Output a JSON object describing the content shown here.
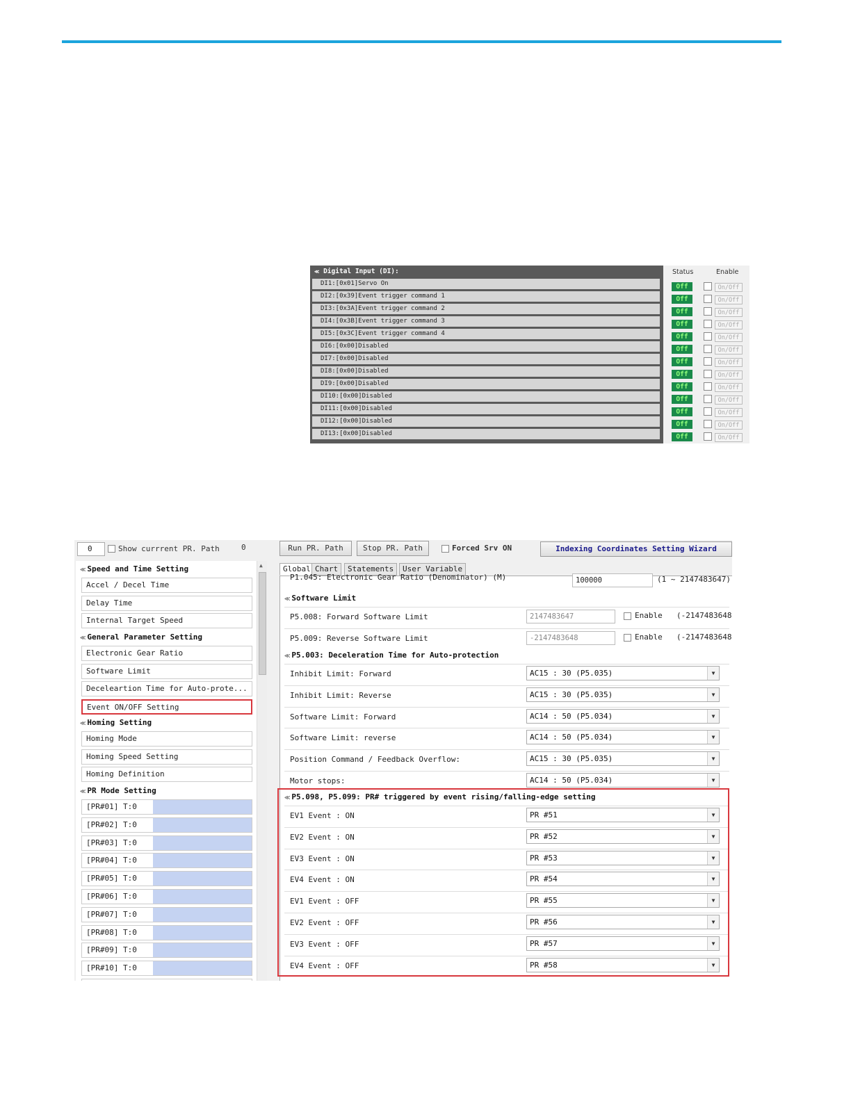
{
  "di_panel": {
    "header": "Digital Input (DI):",
    "status_col": "Status",
    "enable_col": "Enable",
    "status_value": "Off",
    "enable_button": "On/Off",
    "rows": [
      "DI1:[0x01]Servo On",
      "DI2:[0x39]Event trigger command 1",
      "DI3:[0x3A]Event trigger command 2",
      "DI4:[0x3B]Event trigger command 3",
      "DI5:[0x3C]Event trigger command 4",
      "DI6:[0x00]Disabled",
      "DI7:[0x00]Disabled",
      "DI8:[0x00]Disabled",
      "DI9:[0x00]Disabled",
      "DI10:[0x00]Disabled",
      "DI11:[0x00]Disabled",
      "DI12:[0x00]Disabled",
      "DI13:[0x00]Disabled"
    ]
  },
  "toolbar": {
    "pr_number": "0",
    "show_path_label": "Show currrent PR. Path",
    "path_value": "0",
    "run_button": "Run PR. Path",
    "stop_button": "Stop PR. Path",
    "forced_label": "Forced Srv ON",
    "wizard_button": "Indexing Coordinates Setting Wizard"
  },
  "left_panel": {
    "sections": {
      "speed": "Speed and Time Setting",
      "general": "General Parameter Setting",
      "homing": "Homing Setting",
      "pr_mode": "PR Mode Setting"
    },
    "speed_items": [
      "Accel / Decel Time",
      "Delay Time",
      "Internal Target Speed"
    ],
    "general_items": [
      "Electronic Gear Ratio",
      "Software Limit",
      "Deceleartion Time for Auto-prote...",
      "Event ON/OFF Setting"
    ],
    "homing_items": [
      "Homing Mode",
      "Homing Speed Setting",
      "Homing Definition"
    ],
    "pr_items": [
      "[PR#01] T:0",
      "[PR#02] T:0",
      "[PR#03] T:0",
      "[PR#04] T:0",
      "[PR#05] T:0",
      "[PR#06] T:0",
      "[PR#07] T:0",
      "[PR#08] T:0",
      "[PR#09] T:0",
      "[PR#10] T:0"
    ]
  },
  "tabs": [
    "Global",
    "Chart",
    "Statements",
    "User Variable"
  ],
  "right_panel": {
    "partial_row": {
      "label": "P1.045: Electronic Gear Ratio (Denominator) (M)",
      "value": "100000",
      "range": "(1 ~ 2147483647)"
    },
    "software_limit": {
      "title": "Software Limit",
      "rows": [
        {
          "label": "P5.008: Forward Software Limit",
          "value": "2147483647",
          "enable": "Enable",
          "range": "(-2147483648"
        },
        {
          "label": "P5.009: Reverse Software Limit",
          "value": "-2147483648",
          "enable": "Enable",
          "range": "(-2147483648"
        }
      ]
    },
    "decel": {
      "title": "P5.003: Deceleration Time for Auto-protection",
      "rows": [
        {
          "label": "Inhibit Limit: Forward",
          "value": "AC15 : 30 (P5.035)"
        },
        {
          "label": "Inhibit Limit: Reverse",
          "value": "AC15 : 30 (P5.035)"
        },
        {
          "label": "Software Limit: Forward",
          "value": "AC14 : 50 (P5.034)"
        },
        {
          "label": "Software Limit: reverse",
          "value": "AC14 : 50 (P5.034)"
        },
        {
          "label": "Position Command / Feedback Overflow:",
          "value": "AC15 : 30 (P5.035)"
        },
        {
          "label": "Motor stops:",
          "value": "AC14 : 50 (P5.034)"
        }
      ]
    },
    "events": {
      "title": "P5.098, P5.099: PR# triggered by event rising/falling-edge setting",
      "rows": [
        {
          "label": "EV1 Event : ON",
          "value": "PR #51"
        },
        {
          "label": "EV2 Event : ON",
          "value": "PR #52"
        },
        {
          "label": "EV3 Event : ON",
          "value": "PR #53"
        },
        {
          "label": "EV4 Event : ON",
          "value": "PR #54"
        },
        {
          "label": "EV1 Event : OFF",
          "value": "PR #55"
        },
        {
          "label": "EV2 Event : OFF",
          "value": "PR #56"
        },
        {
          "label": "EV3 Event : OFF",
          "value": "PR #57"
        },
        {
          "label": "EV4 Event : OFF",
          "value": "PR #58"
        }
      ]
    }
  },
  "colors": {
    "accent_line": "#1ba4dc",
    "highlight_red": "#d8373d",
    "status_green": "#1a8a4a",
    "pr_fill": "#c5d3f2"
  }
}
